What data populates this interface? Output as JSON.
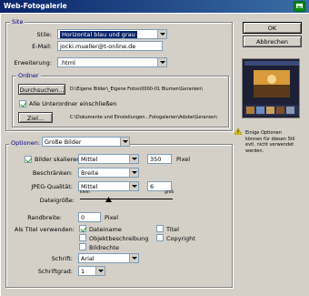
{
  "window": {
    "title": "Web-Fotogalerie"
  },
  "buttons": {
    "ok": "OK",
    "cancel": "Abbrechen"
  },
  "site": {
    "legend": "Site",
    "stile_label": "Stile:",
    "stile_value": "Horizontal blau und grau",
    "email_label": "E-Mail:",
    "email_value": "jocki.mueller@t-online.de",
    "erweiterung_label": "Erweiterung:",
    "erweiterung_value": ".html"
  },
  "ordner": {
    "legend": "Ordner",
    "browse_label": "Durchsuchen...",
    "source_path": "D:\\Eigene Bilder\\_Eigene Fotos\\0000-01 Blumen\\Geranien\\",
    "include_sub_label": "Alle Unterordner einschließen",
    "target_label": "Ziel...",
    "target_path": "C:\\Dokumente und Einstellungen...Fotogalerien\\Adobe\\Geranien\\"
  },
  "optionen": {
    "label": "Optionen:",
    "value": "Große Bilder",
    "scale_label": "Bilder skalieren:",
    "scale_value": "Mittel",
    "scale_px": "350",
    "px_unit": "Pixel",
    "constrain_label": "Beschränken:",
    "constrain_value": "Breite",
    "jpeg_label": "JPEG-Qualität:",
    "jpeg_value": "Mittel",
    "jpeg_number": "6",
    "filesize_label": "Dateigröße:",
    "filesize_small": "klein",
    "filesize_large": "groß",
    "border_label": "Randbreite:",
    "border_value": "0",
    "border_unit": "Pixel",
    "title_use_label": "Als Titel verwenden:",
    "cb_filename": "Dateiname",
    "cb_title": "Titel",
    "cb_caption": "Objektbeschreibung",
    "cb_copyright": "Copyright",
    "cb_credits": "Bildrechte",
    "font_label": "Schrift:",
    "font_value": "Arial",
    "fontsize_label": "Schriftgrad:",
    "fontsize_value": "1"
  },
  "note": {
    "text_1": "Einige Optionen",
    "text_2": "können für diesen Stil",
    "text_3": "evtl. nicht verwendet",
    "text_4": "werden."
  },
  "colors": {
    "titlebar": "#0a246a",
    "legend_text": "#000080",
    "selection": "#0a246a"
  },
  "icons": {
    "app": "green-app-icon",
    "warning": "warning-triangle-icon",
    "dropdown": "chevron-down-icon"
  }
}
